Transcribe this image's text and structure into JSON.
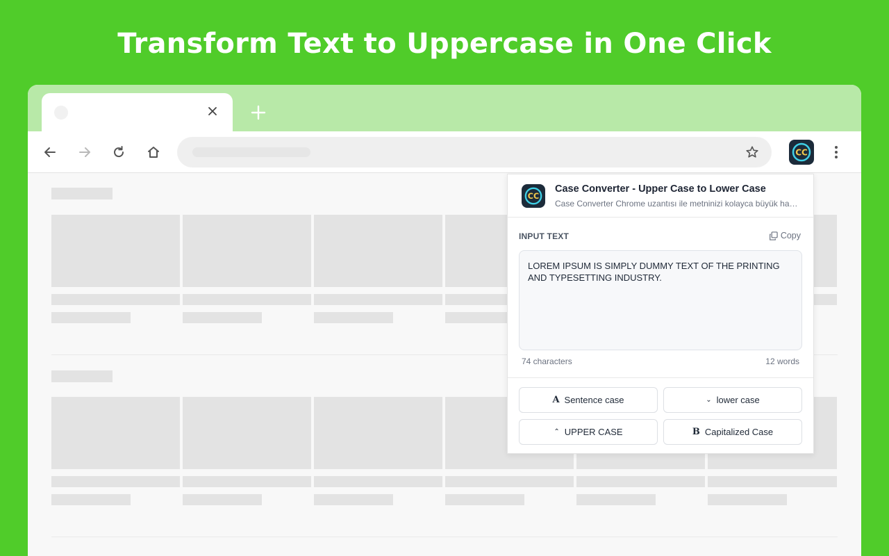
{
  "headline": "Transform Text to Uppercase in One Click",
  "browser": {
    "tab": {
      "close_icon": "close-icon"
    },
    "new_tab_icon": "plus-icon",
    "toolbar": {
      "back_icon": "arrow-left-icon",
      "forward_icon": "arrow-right-icon",
      "reload_icon": "reload-icon",
      "home_icon": "home-icon",
      "bookmark_icon": "star-icon",
      "extension_icon": "case-converter-logo",
      "menu_icon": "kebab-menu-icon"
    }
  },
  "popup": {
    "title": "Case Converter - Upper Case to Lower Case",
    "subtitle": "Case Converter Chrome uzantısı ile metninizi kolayca büyük harfe, küçük harfe ve daha fazlasına dönüştürün",
    "input_label": "INPUT TEXT",
    "copy_label": "Copy",
    "input_value": "LOREM IPSUM IS SIMPLY DUMMY TEXT OF THE PRINTING AND TYPESETTING INDUSTRY.",
    "characters": "74 characters",
    "words": "12 words",
    "buttons": {
      "sentence": {
        "glyph": "A",
        "label": "Sentence case"
      },
      "lower": {
        "glyph": "⌄",
        "label": "lower case"
      },
      "upper": {
        "glyph": "⌃",
        "label": "UPPER CASE"
      },
      "capitalized": {
        "glyph": "B",
        "label": "Capitalized Case"
      }
    }
  },
  "colors": {
    "background": "#50cc2a",
    "tabstrip": "#b8e9a8",
    "placeholder": "#e3e3e3"
  }
}
